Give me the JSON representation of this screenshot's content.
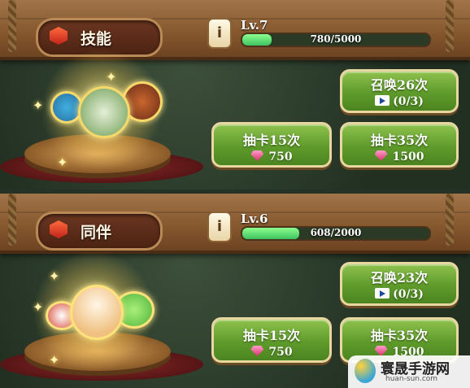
{
  "sections": [
    {
      "title": "技能",
      "level": "Lv.7",
      "xp_text": "780/5000",
      "xp_progress": 0.156,
      "summon_button": {
        "label": "召唤26次",
        "ad_count": "(0/3)"
      },
      "draw_small": {
        "label": "抽卡15次",
        "cost": "750"
      },
      "draw_large": {
        "label": "抽卡35次",
        "cost": "1500"
      }
    },
    {
      "title": "同伴",
      "level": "Lv.6",
      "xp_text": "608/2000",
      "xp_progress": 0.304,
      "summon_button": {
        "label": "召唤23次",
        "ad_count": "(0/3)"
      },
      "draw_small": {
        "label": "抽卡15次",
        "cost": "750"
      },
      "draw_large": {
        "label": "抽卡35次",
        "cost": "1500"
      }
    }
  ],
  "watermark": {
    "main": "寰晟手游网",
    "sub": "huan-sun.com"
  },
  "colors": {
    "button_green": "#5e9b2b",
    "xp_green": "#3ec260",
    "gem_pink": "#d9326d",
    "title_red": "#c0231a"
  }
}
